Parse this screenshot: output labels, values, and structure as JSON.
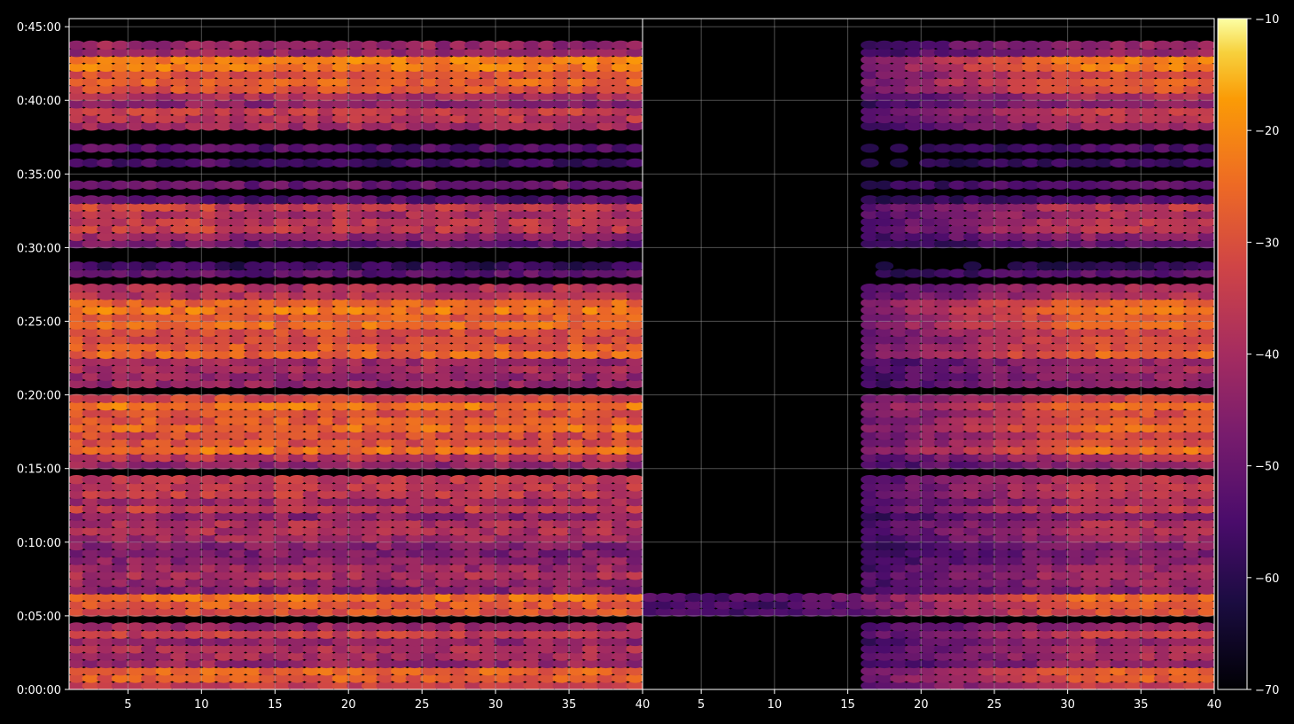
{
  "chart_data": [
    {
      "type": "heatmap",
      "panel": "left",
      "title": "",
      "xlabel": "",
      "ylabel": "",
      "xlim": [
        1,
        40
      ],
      "x_ticks": [
        5,
        10,
        15,
        20,
        25,
        30,
        35,
        40
      ],
      "y_ticks": [
        "0:00:00",
        "0:05:00",
        "0:10:00",
        "0:15:00",
        "0:20:00",
        "0:25:00",
        "0:30:00",
        "0:35:00",
        "0:40:00",
        "0:45:00"
      ],
      "ylim_minutes": [
        0,
        45
      ],
      "grid": true,
      "columns": 39,
      "rows": 88,
      "row_interval_seconds": 30,
      "value_range_db": [
        -70,
        -10
      ],
      "hot_bands_minutes": [
        [
          0.3,
          1.5
        ],
        [
          5.1,
          6.6
        ],
        [
          16.0,
          19.9
        ],
        [
          22.5,
          26.5
        ],
        [
          40.5,
          43.2
        ]
      ],
      "active_bands_minutes": [
        [
          0.0,
          4.3
        ],
        [
          4.8,
          9.8
        ],
        [
          10.2,
          14.4
        ],
        [
          14.9,
          19.9
        ],
        [
          20.4,
          23.9
        ],
        [
          24.5,
          27.3
        ],
        [
          30.5,
          33.2
        ],
        [
          37.8,
          43.8
        ]
      ]
    },
    {
      "type": "heatmap",
      "panel": "right",
      "title": "",
      "xlabel": "",
      "ylabel": "",
      "xlim": [
        1,
        40
      ],
      "x_ticks": [
        5,
        10,
        15,
        20,
        25,
        30,
        35,
        40
      ],
      "ylim_minutes": [
        0,
        45
      ],
      "grid": true,
      "columns": 39,
      "rows": 88,
      "row_interval_seconds": 30,
      "value_range_db": [
        -70,
        -10
      ],
      "note_active_columns_from": 15
    }
  ],
  "colorbar": {
    "colormap": "inferno",
    "ticks": [
      "−10",
      "−20",
      "−30",
      "−40",
      "−50",
      "−60",
      "−70"
    ],
    "tick_values": [
      -10,
      -20,
      -30,
      -40,
      -50,
      -60,
      -70
    ],
    "range": [
      -70,
      -10
    ]
  },
  "colors": {
    "background": "#000000",
    "axis": "#ffffff",
    "grid": "#b0b0b0"
  }
}
